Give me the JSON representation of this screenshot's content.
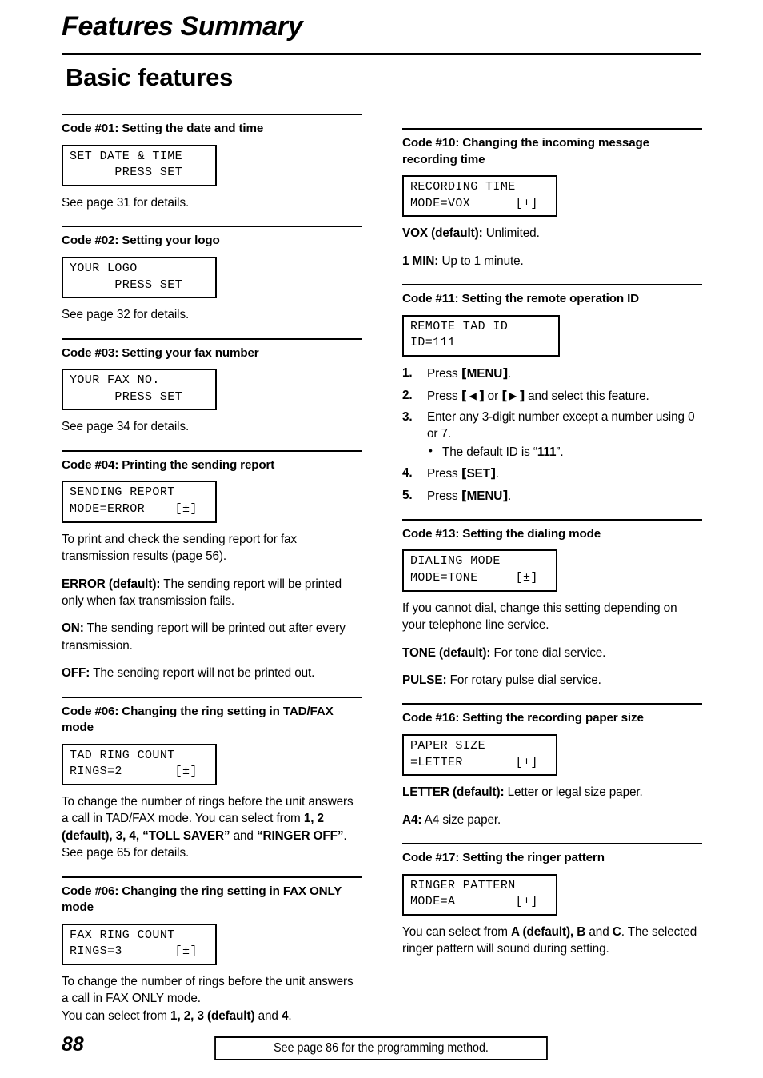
{
  "header": {
    "doc_title": "Features Summary",
    "section_title": "Basic features"
  },
  "left_column": [
    {
      "heading": "Code #01: Setting the date and time",
      "lcd": "SET DATE & TIME\n      PRESS SET",
      "lcd_size": "w-sm",
      "paragraphs": [
        {
          "html": "See page 31 for details."
        }
      ]
    },
    {
      "heading": "Code #02: Setting your logo",
      "lcd": "YOUR LOGO\n      PRESS SET",
      "lcd_size": "w-sm",
      "paragraphs": [
        {
          "html": "See page 32 for details."
        }
      ]
    },
    {
      "heading": "Code #03: Setting your fax number",
      "lcd": "YOUR FAX NO.\n      PRESS SET",
      "lcd_size": "w-sm",
      "paragraphs": [
        {
          "html": "See page 34 for details."
        }
      ]
    },
    {
      "heading": "Code #04: Printing the sending report",
      "lcd": "SENDING REPORT\nMODE=ERROR    [±]",
      "lcd_size": "w-md",
      "paragraphs": [
        {
          "html": "To print and check the sending report for fax transmission results (page 56)."
        },
        {
          "html": "<b>ERROR (default):</b> The sending report will be printed only when fax transmission fails."
        },
        {
          "html": "<b>ON:</b> The sending report will be printed out after every transmission."
        },
        {
          "html": "<b>OFF:</b> The sending report will not be printed out."
        }
      ]
    },
    {
      "heading": "Code #06: Changing the ring setting in TAD/FAX mode",
      "lcd": "TAD RING COUNT\nRINGS=2       [±]",
      "lcd_size": "w-md",
      "paragraphs": [
        {
          "html": "To change the number of rings before the unit answers a call in TAD/FAX mode. You can select from <b>1, 2 (default), 3, 4, “TOLL SAVER”</b> and <b>“RINGER OFF”</b>. See page 65 for details."
        }
      ]
    },
    {
      "heading": "Code #06: Changing the ring setting in FAX ONLY mode",
      "lcd": "FAX RING COUNT\nRINGS=3       [±]",
      "lcd_size": "w-md",
      "paragraphs": [
        {
          "html": "To change the number of rings before the unit answers a call in FAX ONLY mode.<br>You can select from <b>1, 2, 3 (default)</b> and <b>4</b>."
        }
      ]
    }
  ],
  "right_column": [
    {
      "heading": "Code #10: Changing the incoming message recording time",
      "lcd": "RECORDING TIME\nMODE=VOX      [±]",
      "lcd_size": "w-md",
      "paragraphs": [
        {
          "html": "<b>VOX (default):</b> Unlimited."
        },
        {
          "html": "<b>1 MIN:</b> Up to 1 minute."
        }
      ]
    },
    {
      "heading": "Code #11: Setting the remote operation ID",
      "lcd": "REMOTE TAD ID\nID=111",
      "lcd_size": "w-lg",
      "steps": [
        {
          "num": "1.",
          "html": "Press <span class=\"key\"><span class=\"brk\">[</span>MENU<span class=\"brk\">]</span></span>."
        },
        {
          "num": "2.",
          "html": "Press <span class=\"key\"><span class=\"brk\">[</span><span class=\"arrow\">◀</span><span class=\"brk\">]</span></span> or <span class=\"key\"><span class=\"brk\">[</span><span class=\"arrow\">▶</span><span class=\"brk\">]</span></span> and select this feature."
        },
        {
          "num": "3.",
          "html": "Enter any 3-digit number except a number using 0 or 7.",
          "bullets": [
            "The default ID is “<b>111</b>”."
          ]
        },
        {
          "num": "4.",
          "html": "Press <span class=\"key\"><span class=\"brk\">[</span>SET<span class=\"brk\">]</span></span>."
        },
        {
          "num": "5.",
          "html": "Press <span class=\"key\"><span class=\"brk\">[</span>MENU<span class=\"brk\">]</span></span>."
        }
      ]
    },
    {
      "heading": "Code #13: Setting the dialing mode",
      "lcd": "DIALING MODE\nMODE=TONE     [±]",
      "lcd_size": "w-md",
      "paragraphs": [
        {
          "html": "If you cannot dial, change this setting depending on your telephone line service."
        },
        {
          "html": "<b>TONE (default):</b> For tone dial service."
        },
        {
          "html": "<b>PULSE:</b> For rotary pulse dial service."
        }
      ]
    },
    {
      "heading": "Code #16: Setting the recording paper size",
      "lcd": "PAPER SIZE\n=LETTER       [±]",
      "lcd_size": "w-md",
      "paragraphs": [
        {
          "html": "<b>LETTER (default):</b> Letter or legal size paper."
        },
        {
          "html": "<b>A4:</b> A4 size paper."
        }
      ]
    },
    {
      "heading": "Code #17: Setting the ringer pattern",
      "lcd": "RINGER PATTERN\nMODE=A        [±]",
      "lcd_size": "w-md",
      "paragraphs": [
        {
          "html": "You can select from <b>A (default), B</b> and <b>C</b>. The selected ringer pattern will sound during setting."
        }
      ]
    }
  ],
  "footer": {
    "page_number": "88",
    "note": "See page 86 for the programming method."
  }
}
